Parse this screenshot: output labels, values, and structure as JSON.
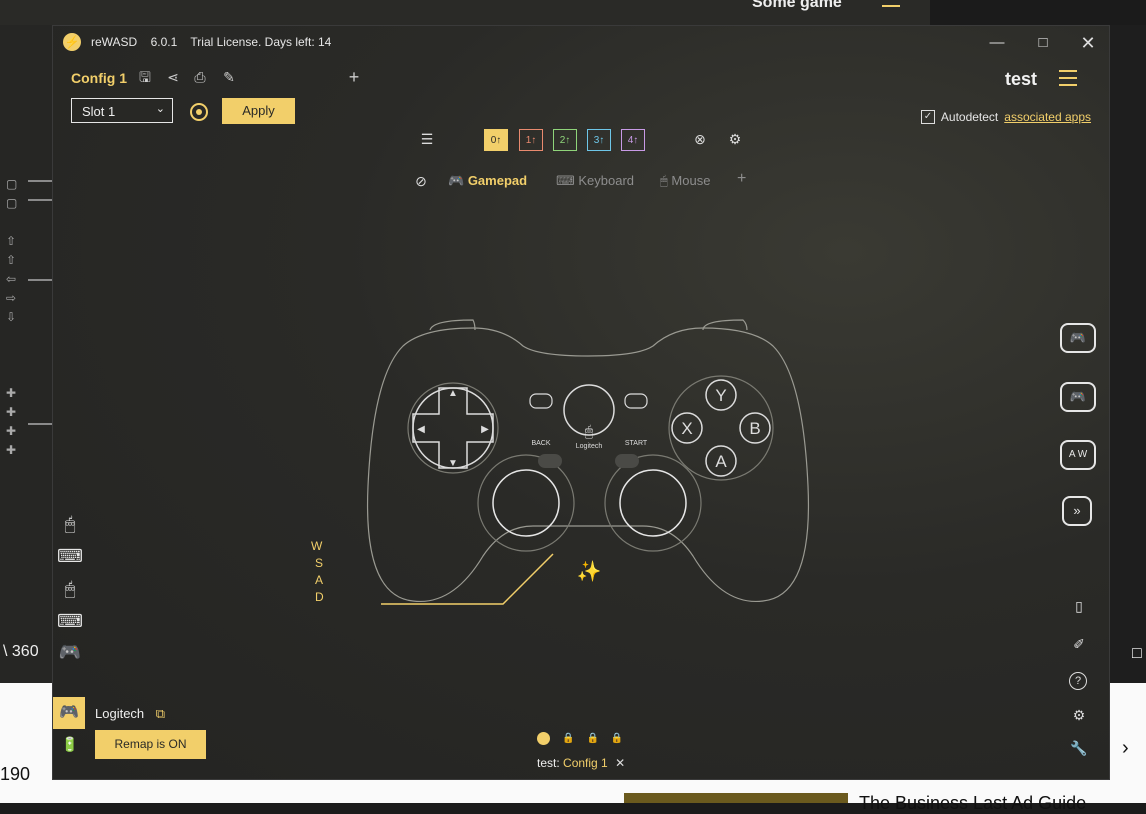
{
  "background": {
    "top_right_text": "Some game",
    "left_bottom_text": "\\ 360",
    "bottom_number": "190",
    "bottom_right_text": "The Business Last Ad Guide"
  },
  "titlebar": {
    "app_name": "reWASD",
    "version": "6.0.1",
    "license": "Trial License. Days left: 14"
  },
  "toolbar": {
    "config_name": "Config 1",
    "slot": "Slot 1",
    "apply_label": "Apply"
  },
  "profile": {
    "name": "test",
    "autodetect_label": "Autodetect",
    "associated_apps": "associated apps"
  },
  "layers": [
    "0",
    "1",
    "2",
    "3",
    "4"
  ],
  "layer_colors": [
    "#f2cf6a",
    "#e98a6f",
    "#8fd47a",
    "#6ec6e8",
    "#c89ae6"
  ],
  "device_tabs": {
    "gamepad": "Gamepad",
    "keyboard": "Keyboard",
    "mouse": "Mouse"
  },
  "gamepad": {
    "back": "BACK",
    "start": "START",
    "brand": "Logitech",
    "y": "Y",
    "x": "X",
    "b": "B",
    "a": "A",
    "left_stick_mapping": [
      "W",
      "S",
      "A",
      "D"
    ]
  },
  "footer": {
    "device_name": "Logitech",
    "remap_label": "Remap is ON",
    "profile_prefix": "test:",
    "config": "Config 1"
  }
}
